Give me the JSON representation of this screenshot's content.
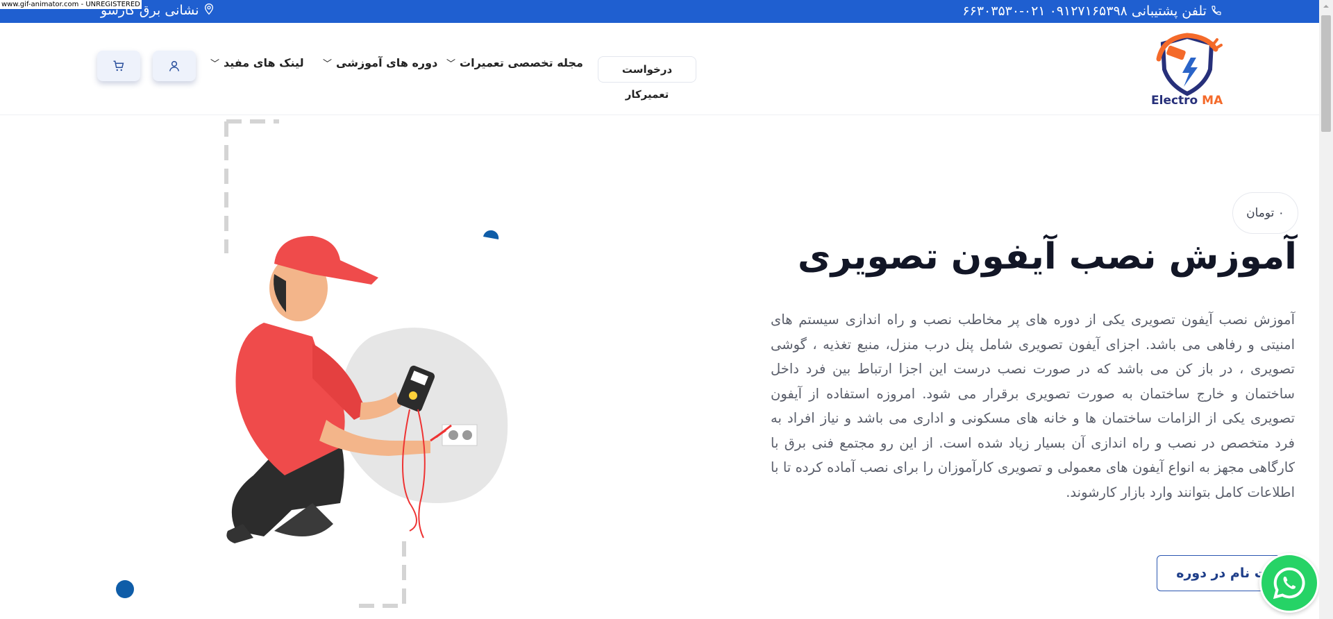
{
  "watermark": "www.gif-animator.com - UNREGISTERED",
  "topbar": {
    "phone_text": "تلفن پشتیبانی ۰۹۱۲۷۱۶۵۳۹۸  ۰۲۱-۶۶۳۰۳۵۳۰",
    "address_text": "نشانی برق کارسو",
    "phone_icon": "phone-icon",
    "address_icon": "location-pin-icon"
  },
  "header": {
    "logo_text_1": "Electro",
    "logo_text_2": "MA",
    "nav": {
      "repair_request": "درخواست تعمیرکار",
      "magazine": "مجله تخصصی تعمیرات",
      "courses": "دوره های آموزشی",
      "links": "لینک های مفید"
    },
    "user_icon": "user-icon",
    "cart_icon": "cart-icon"
  },
  "hero": {
    "price": "۰ تومان",
    "title": "آموزش نصب آیفون تصویری",
    "description": "آموزش نصب آیفون تصویری یکی از دوره های پر مخاطب نصب و راه اندازی سیستم های امنیتی و رفاهی می باشد. اجزای آیفون تصویری شامل پنل درب منزل، منبع تغذیه ، گوشی تصویری ، در باز کن می باشد که در صورت نصب درست این اجزا ارتباط بین فرد داخل ساختمان و خارج ساختمان به صورت تصویری برقرار می شود. امروزه استفاده از آیفون تصویری یکی از الزامات ساختمان ها و خانه های مسکونی و اداری می باشد و نیاز افراد به فرد متخصص در نصب و راه اندازی آن بسیار زیاد شده است. از این رو مجتمع فنی برق با کارگاهی مجهز به انواع آیفون های معمولی و تصویری کارآموزان را برای نصب آماده کرده تا با اطلاعات کامل بتوانند وارد بازار کارشوند.",
    "register_button": "ثبت نام در دوره"
  },
  "colors": {
    "topbar": "#1f5fd0",
    "accent": "#2a56b0",
    "logo_orange": "#f46a2a",
    "whatsapp": "#26d366"
  }
}
